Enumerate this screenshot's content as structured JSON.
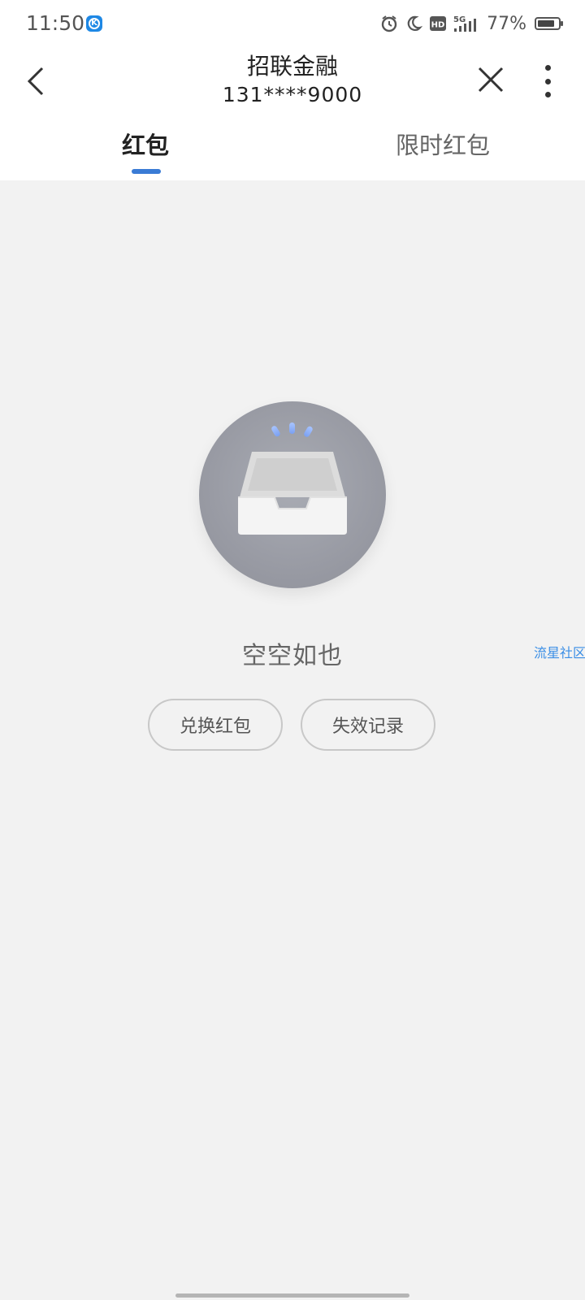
{
  "status_bar": {
    "time": "11:50",
    "battery_percent": "77%",
    "icons": [
      "alarm-icon",
      "moon-icon",
      "hd-icon",
      "5g-signal-icon",
      "battery-icon"
    ]
  },
  "nav": {
    "title": "招联金融",
    "subtitle": "131****9000",
    "back_icon": "chevron-left-icon",
    "close_icon": "close-icon",
    "more_icon": "more-vertical-icon"
  },
  "tabs": [
    {
      "label": "红包",
      "active": true
    },
    {
      "label": "限时红包",
      "active": false
    }
  ],
  "accent_color": "#3a7bd5",
  "empty_state": {
    "message": "空空如也",
    "illustration": "empty-tray-icon"
  },
  "buttons": {
    "redeem_label": "兑换红包",
    "expired_label": "失效记录"
  },
  "watermark": "流星社区"
}
